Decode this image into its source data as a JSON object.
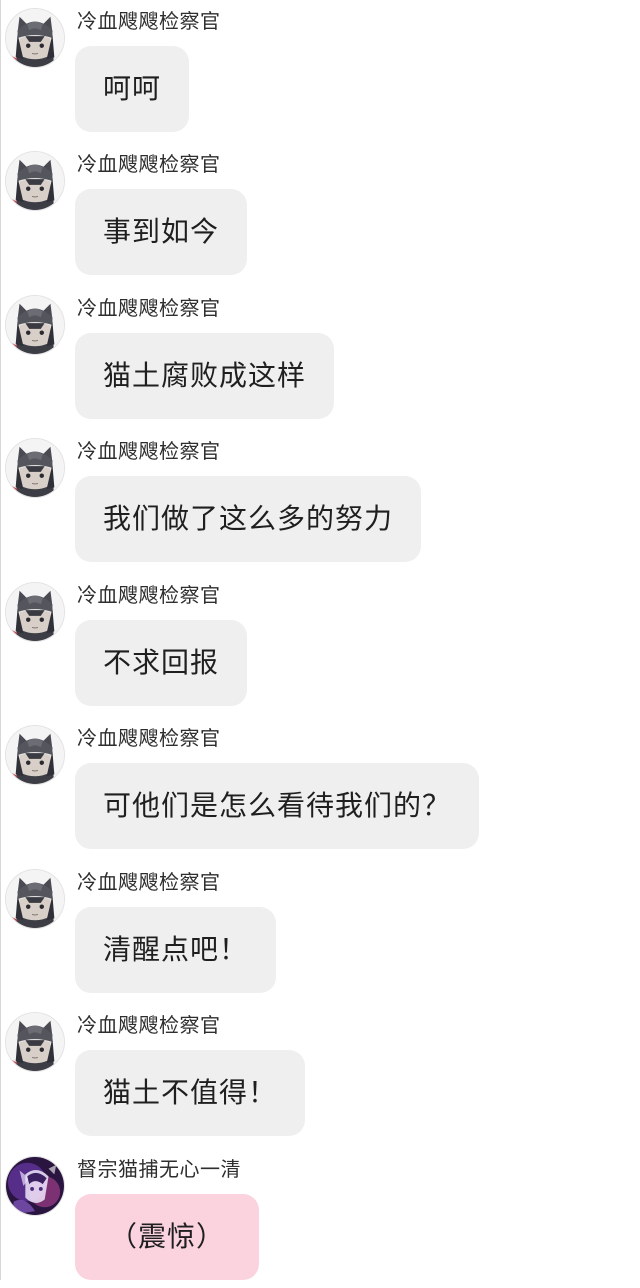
{
  "messages": [
    {
      "sender": "冷血飕飕检察官",
      "text": "呵呵",
      "avatar_icon": "gray-wolf-character-avatar-icon"
    },
    {
      "sender": "冷血飕飕检察官",
      "text": "事到如今",
      "avatar_icon": "gray-wolf-character-avatar-icon"
    },
    {
      "sender": "冷血飕飕检察官",
      "text": "猫土腐败成这样",
      "avatar_icon": "gray-wolf-character-avatar-icon"
    },
    {
      "sender": "冷血飕飕检察官",
      "text": "我们做了这么多的努力",
      "avatar_icon": "gray-wolf-character-avatar-icon"
    },
    {
      "sender": "冷血飕飕检察官",
      "text": "不求回报",
      "avatar_icon": "gray-wolf-character-avatar-icon"
    },
    {
      "sender": "冷血飕飕检察官",
      "text": "可他们是怎么看待我们的？",
      "avatar_icon": "gray-wolf-character-avatar-icon"
    },
    {
      "sender": "冷血飕飕检察官",
      "text": "清醒点吧！",
      "avatar_icon": "gray-wolf-character-avatar-icon"
    },
    {
      "sender": "冷血飕飕检察官",
      "text": "猫土不值得！",
      "avatar_icon": "gray-wolf-character-avatar-icon"
    },
    {
      "sender": "督宗猫捕无心一清",
      "text": "（震惊）",
      "avatar_icon": "purple-cat-character-avatar-icon"
    }
  ],
  "colors": {
    "bubble_default": "#efefef",
    "bubble_highlight": "#fbd3df",
    "text": "#1f1f1f",
    "sender_text": "#2e2e2e",
    "background": "#ffffff"
  }
}
